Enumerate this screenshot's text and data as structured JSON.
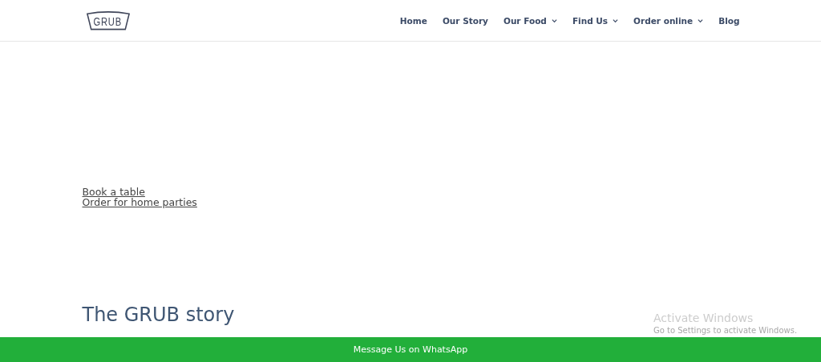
{
  "header": {
    "logo": "GRUB",
    "nav": [
      {
        "label": "Home",
        "dropdown": false
      },
      {
        "label": "Our Story",
        "dropdown": false
      },
      {
        "label": "Our Food",
        "dropdown": true
      },
      {
        "label": "Find Us",
        "dropdown": true
      },
      {
        "label": "Order online",
        "dropdown": true
      },
      {
        "label": "Blog",
        "dropdown": false
      }
    ]
  },
  "links": [
    "Book a table",
    "Order for home parties"
  ],
  "heading": "The GRUB story",
  "whatsapp_bar": "Message Us on WhatsApp",
  "os_overlay": {
    "title": "Activate Windows",
    "subtitle": "Go to Settings to activate Windows."
  }
}
